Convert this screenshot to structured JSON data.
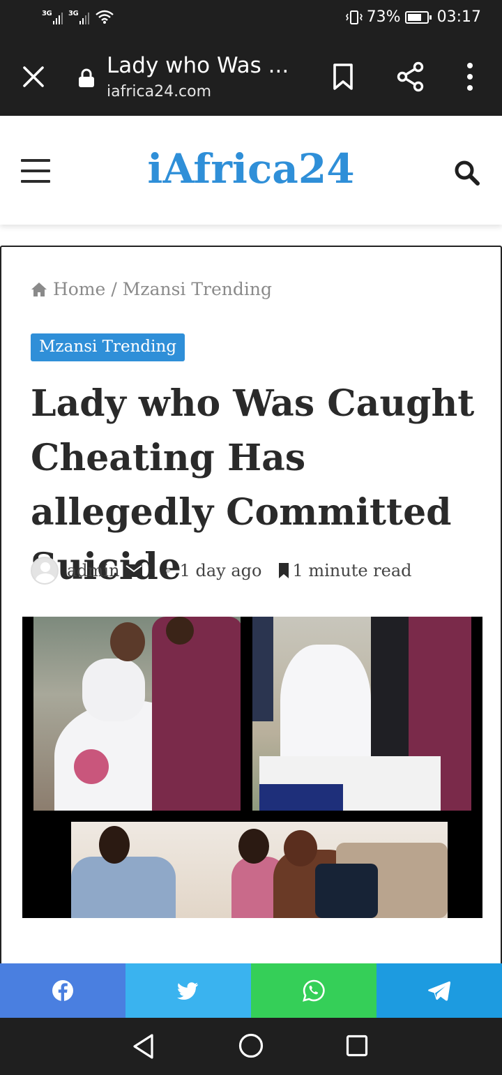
{
  "status_bar": {
    "signal1_label": "3G",
    "signal2_label": "3G",
    "battery": "73%",
    "battery_level": 0.73,
    "time": "03:17"
  },
  "browser": {
    "page_title": "Lady who Was ...",
    "url": "iafrica24.com",
    "icons": [
      "close-icon",
      "lock-icon",
      "bookmark-icon",
      "share-icon",
      "more-vert-icon"
    ]
  },
  "site": {
    "logo": "iAfrica24",
    "icons": [
      "hamburger-menu-icon",
      "search-icon"
    ]
  },
  "article": {
    "breadcrumb": {
      "home": "Home",
      "separator": "/",
      "current": "Mzansi Trending"
    },
    "category": "Mzansi Trending",
    "title": "Lady who Was Caught Cheating Has allegedly Committed Suicide",
    "author": "admin",
    "date": "1 day ago",
    "read_time": "1 minute read"
  },
  "share_buttons": [
    {
      "network": "facebook",
      "icon": "facebook-icon",
      "color": "#4a7fe0"
    },
    {
      "network": "twitter",
      "icon": "twitter-icon",
      "color": "#3ab3ef"
    },
    {
      "network": "whatsapp",
      "icon": "whatsapp-icon",
      "color": "#35cf58"
    },
    {
      "network": "telegram",
      "icon": "telegram-icon",
      "color": "#1d9be0"
    }
  ],
  "colors": {
    "accent": "#2f8fd8",
    "system_bar": "#1f1f1f"
  }
}
